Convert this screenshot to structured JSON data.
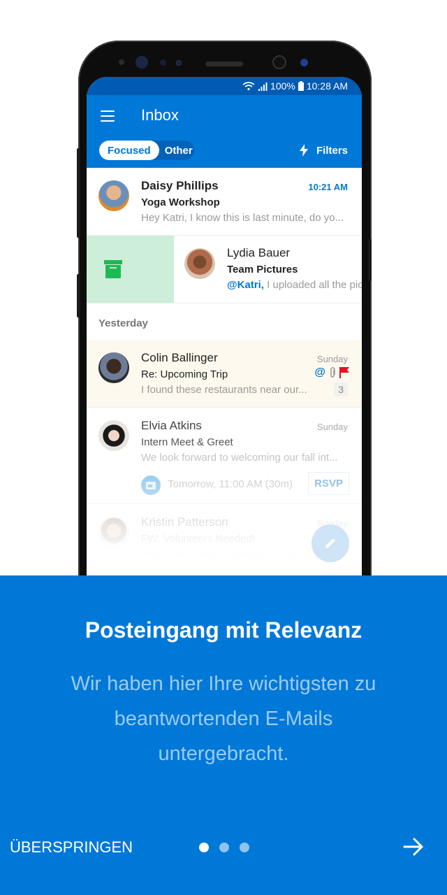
{
  "status_bar": {
    "battery": "100%",
    "time": "10:28 AM"
  },
  "app_bar": {
    "title": "Inbox",
    "tabs": [
      {
        "label": "Focused",
        "active": true
      },
      {
        "label": "Other",
        "active": false
      }
    ],
    "filters_label": "Filters"
  },
  "emails": [
    {
      "sender": "Daisy Phillips",
      "subject": "Yoga Workshop",
      "preview": "Hey Katri, I know this is last minute, do yo...",
      "time": "10:21 AM",
      "unread": true
    },
    {
      "sender": "Lydia Bauer",
      "subject": "Team Pictures",
      "mention": "@Katri,",
      "preview": " I uploaded all the pic",
      "swipe_action": "archive"
    }
  ],
  "section_label": "Yesterday",
  "older_emails": [
    {
      "sender": "Colin Ballinger",
      "subject": "Re: Upcoming Trip",
      "preview": "I found these restaurants near our...",
      "time": "Sunday",
      "thread_count": "3",
      "indicators": [
        "mention",
        "attachment",
        "flag"
      ]
    },
    {
      "sender": "Elvia Atkins",
      "subject": "Intern Meet & Greet",
      "preview": "We look forward to welcoming our fall int...",
      "time": "Sunday",
      "event_time": "Tomorrow, 11:00 AM (30m)",
      "rsvp_label": "RSVP"
    },
    {
      "sender": "Kristin Patterson",
      "subject": "FW: Volunteers Needed!",
      "preview": "Hey Alumni! We're looking for volunt",
      "time": "Sunday"
    }
  ],
  "onboarding": {
    "title": "Posteingang mit Relevanz",
    "body": "Wir haben hier Ihre wichtigsten zu beantwortenden E-Mails untergebracht.",
    "skip_label": "ÜBERSPRINGEN",
    "page_count": 3,
    "current_page": 1
  },
  "colors": {
    "brand_blue": "#0078d7",
    "status_blue": "#005bb5",
    "archive_green": "#1db954",
    "flag_red": "#e81123",
    "highlight_bg": "#fdf9ef"
  }
}
